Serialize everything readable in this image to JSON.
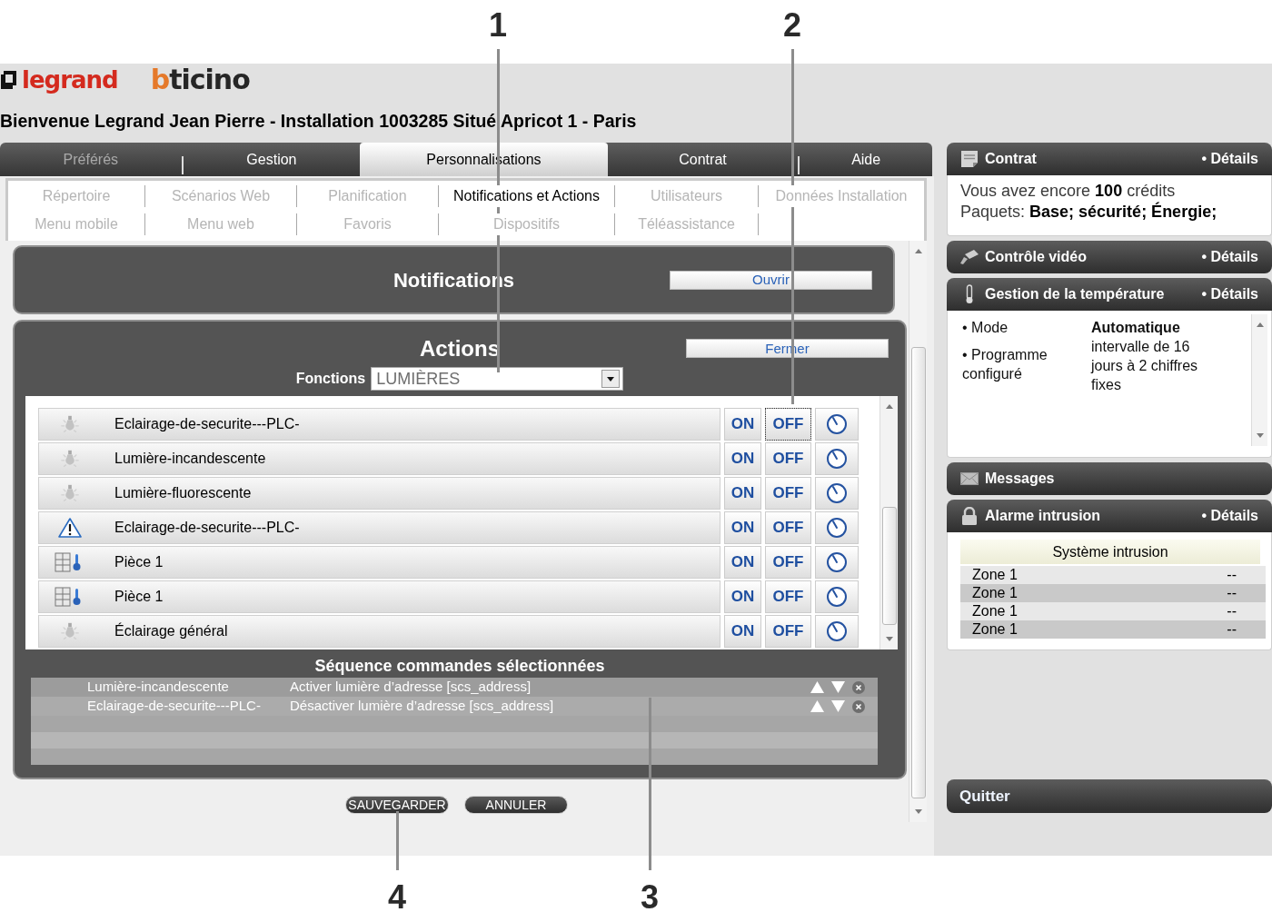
{
  "callouts": [
    {
      "label": "1"
    },
    {
      "label": "2"
    },
    {
      "label": "3"
    },
    {
      "label": "4"
    }
  ],
  "header": {
    "logos": [
      {
        "kind": "legrand",
        "text": "legrand"
      },
      {
        "kind": "bticino",
        "text": "bticino"
      }
    ],
    "welcome": "Bienvenue Legrand Jean Pierre - Installation 1003285 Situé Apricot 1 - Paris"
  },
  "tabs": [
    {
      "label": "Préférés",
      "selected": false,
      "disabled": true
    },
    {
      "label": "Gestion",
      "selected": false,
      "disabled": false
    },
    {
      "label": "Personnalisations",
      "selected": true,
      "disabled": false
    },
    {
      "label": "Contrat",
      "selected": false,
      "disabled": false
    },
    {
      "label": "Aide",
      "selected": false,
      "disabled": false
    }
  ],
  "subtab_rows": [
    [
      {
        "label": "Répertoire",
        "selected": false
      },
      {
        "label": "Scénarios Web",
        "selected": false
      },
      {
        "label": "Planification",
        "selected": false
      },
      {
        "label": "Notifications et Actions",
        "selected": true
      },
      {
        "label": "Utilisateurs",
        "selected": false
      },
      {
        "label": "Données Installation",
        "selected": false
      }
    ],
    [
      {
        "label": "Menu mobile",
        "selected": false
      },
      {
        "label": "Menu web",
        "selected": false
      },
      {
        "label": "Favoris",
        "selected": false
      },
      {
        "label": "Dispositifs",
        "selected": false
      },
      {
        "label": "Téléassistance",
        "selected": false
      }
    ]
  ],
  "notifications": {
    "title": "Notifications",
    "button": "Ouvrir"
  },
  "actions": {
    "title": "Actions",
    "button": "Fermer",
    "filter": {
      "label": "Fonctions",
      "value": "LUMIÈRES"
    },
    "devices": [
      {
        "kind": "light",
        "name": "Eclairage-de-securite---PLC-",
        "on_label": "ON",
        "off_label": "OFF",
        "focused": true
      },
      {
        "kind": "light",
        "name": "Lumière-incandescente",
        "on_label": "ON",
        "off_label": "OFF",
        "focused": false
      },
      {
        "kind": "light",
        "name": "Lumière-fluorescente",
        "on_label": "ON",
        "off_label": "OFF",
        "focused": false
      },
      {
        "kind": "alert",
        "name": "Eclairage-de-securite---PLC-",
        "on_label": "ON",
        "off_label": "OFF",
        "focused": false
      },
      {
        "kind": "thermostat",
        "name": "Pièce 1",
        "on_label": "ON",
        "off_label": "OFF",
        "focused": false
      },
      {
        "kind": "thermostat",
        "name": "Pièce 1",
        "on_label": "ON",
        "off_label": "OFF",
        "focused": false
      },
      {
        "kind": "light",
        "name": "Éclairage général",
        "on_label": "ON",
        "off_label": "OFF",
        "focused": false
      }
    ],
    "sequence": {
      "title": "Séquence commandes sélectionnées",
      "rows": [
        {
          "device": "Lumière-incandescente",
          "action": "Activer lumière d’adresse [scs_address]"
        },
        {
          "device": "Eclairage-de-securite---PLC-",
          "action": "Désactiver lumière d’adresse [scs_address]"
        }
      ]
    }
  },
  "footer_buttons": [
    {
      "label": "SAUVEGARDER"
    },
    {
      "label": "ANNULER"
    }
  ],
  "sidebar": {
    "widgets": [
      {
        "kind": "contract",
        "title": "Contrat",
        "link": "• Détails",
        "lines": [
          "Vous avez encore **100** crédits",
          "Paquets: **Base; sécurité; Énergie;**"
        ]
      },
      {
        "kind": "video",
        "title": "Contrôle vidéo",
        "link": "• Détails"
      },
      {
        "kind": "temperature",
        "title": "Gestion de la température",
        "link": "• Détails",
        "rows": [
          {
            "kind": "mode",
            "label": "• Mode",
            "value": "Automatique"
          },
          {
            "kind": "program",
            "label": "• Programme configuré",
            "value": "intervalle de 16 jours à 2 chiffres fixes"
          }
        ]
      },
      {
        "kind": "messages",
        "title": "Messages"
      },
      {
        "kind": "alarm",
        "title": "Alarme intrusion",
        "link": "• Détails",
        "table": {
          "heading": "Système intrusion",
          "rows": [
            {
              "zone": "Zone 1",
              "status": "--"
            },
            {
              "zone": "Zone 1",
              "status": "--"
            },
            {
              "zone": "Zone 1",
              "status": "--"
            },
            {
              "zone": "Zone 1",
              "status": "--"
            }
          ]
        }
      }
    ],
    "quit": "Quitter"
  }
}
